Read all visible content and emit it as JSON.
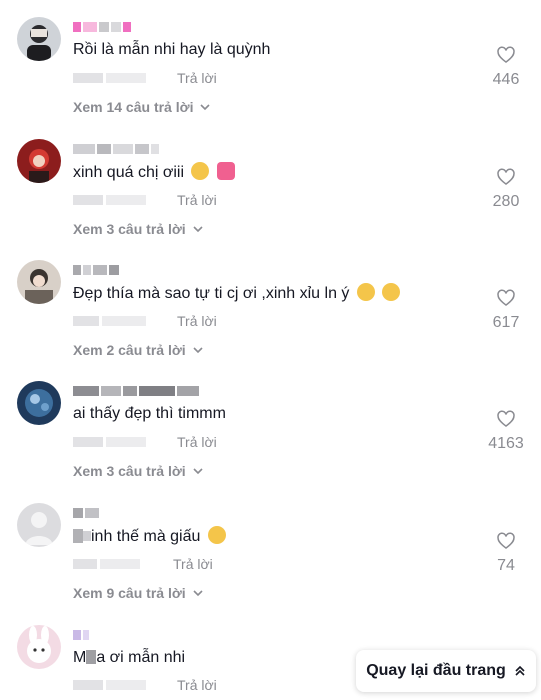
{
  "reply_label": "Trả lời",
  "back_to_top": "Quay lại đầu trang",
  "comments": [
    {
      "text": "Rồi là mẫn nhi hay là quỳnh",
      "likes": "446",
      "view_replies": "Xem 14 câu trả lời"
    },
    {
      "text": "xinh quá chị ơiii",
      "likes": "280",
      "view_replies": "Xem 3 câu trả lời"
    },
    {
      "text": "Đẹp thía mà sao tự ti cj ơi ,xinh xỉu ln ý",
      "likes": "617",
      "view_replies": "Xem 2 câu trả lời"
    },
    {
      "text": "ai thấy đẹp thì timmm",
      "likes": "4163",
      "view_replies": "Xem 3 câu trả lời"
    },
    {
      "text": "inh thế mà giấu",
      "likes": "74",
      "view_replies": "Xem 9 câu trả lời"
    },
    {
      "text": "a ơi mẫn nhi",
      "likes": "",
      "view_replies": ""
    }
  ],
  "colors": {
    "text": "#161823",
    "muted": "#8a8b91",
    "pixelated": "#d9d9dc",
    "pink": "#f06fc0"
  }
}
